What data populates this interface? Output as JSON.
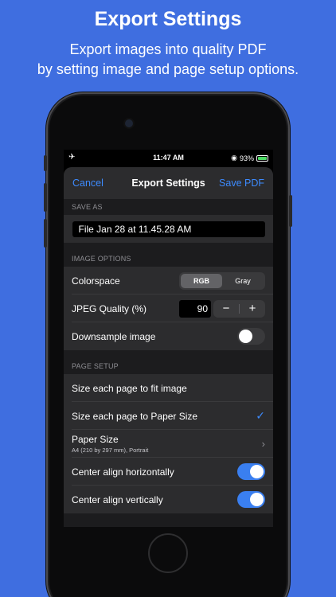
{
  "promo": {
    "title": "Export Settings",
    "subtitle_line1": "Export images into quality PDF",
    "subtitle_line2": "by setting image and page setup options."
  },
  "status_bar": {
    "time": "11:47 AM",
    "battery": "93%",
    "airplane_icon": "airplane-icon"
  },
  "nav": {
    "cancel": "Cancel",
    "title": "Export Settings",
    "save": "Save PDF"
  },
  "save_as": {
    "header": "SAVE AS",
    "filename": "File Jan 28 at 11.45.28 AM"
  },
  "image_options": {
    "header": "IMAGE OPTIONS",
    "colorspace_label": "Colorspace",
    "colorspace_options": [
      "RGB",
      "Gray"
    ],
    "colorspace_selected": "RGB",
    "jpeg_label": "JPEG Quality (%)",
    "jpeg_value": "90",
    "minus": "−",
    "plus": "+",
    "downsample_label": "Downsample image",
    "downsample_on": false
  },
  "page_setup": {
    "header": "PAGE SETUP",
    "fit_image_label": "Size each page to fit image",
    "paper_size_fit_label": "Size each page to Paper Size",
    "paper_size_label": "Paper Size",
    "paper_size_value": "A4 (210 by 297 mm), Portrait",
    "center_h_label": "Center align horizontally",
    "center_h_on": true,
    "center_v_label": "Center align vertically",
    "center_v_on": true
  },
  "colors": {
    "background": "#3f6ee0",
    "accent": "#3d8bff",
    "toggle_on": "#3a7ff0"
  }
}
